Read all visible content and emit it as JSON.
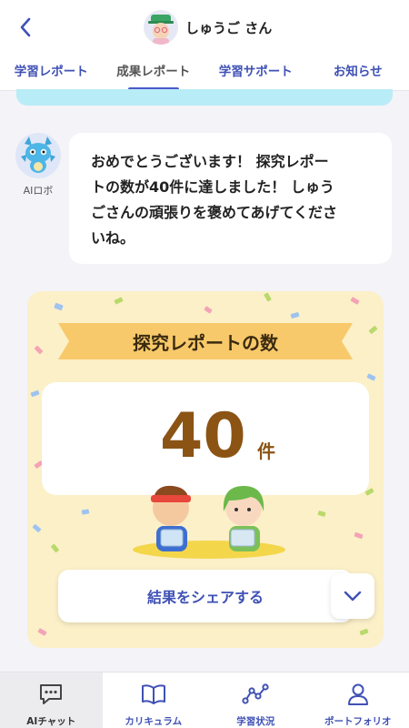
{
  "header": {
    "user_name": "しゅうご さん"
  },
  "tabs": [
    {
      "label": "学習レポート"
    },
    {
      "label": "成果レポート"
    },
    {
      "label": "学習サポート"
    },
    {
      "label": "お知らせ"
    }
  ],
  "chat": {
    "bot_label": "AIロボ",
    "message_lines": [
      "おめでとうございます！ 探究レポー",
      "トの数が40件に達しました！ しゅう",
      "ごさんの頑張りを褒めてあげてくださ",
      "いね。"
    ]
  },
  "achievement": {
    "title": "探究レポートの数",
    "value": "40",
    "unit": "件",
    "share_label": "結果をシェアする"
  },
  "bottom_nav": [
    {
      "label": "AIチャット",
      "icon": "chat-icon"
    },
    {
      "label": "カリキュラム",
      "icon": "book-icon"
    },
    {
      "label": "学習状況",
      "icon": "line-chart-icon"
    },
    {
      "label": "ポートフォリオ",
      "icon": "person-icon"
    }
  ],
  "colors": {
    "accent": "#3f51b5",
    "card_bg": "#fbf0c8",
    "ribbon": "#f8c96a",
    "count": "#8b5414",
    "strip": "#b8ecf7"
  }
}
